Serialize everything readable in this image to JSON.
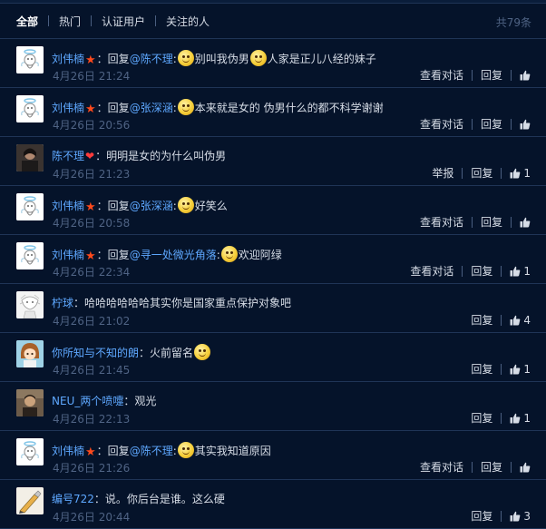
{
  "tabs": [
    {
      "label": "全部",
      "active": true
    },
    {
      "label": "热门",
      "active": false
    },
    {
      "label": "认证用户",
      "active": false
    },
    {
      "label": "关注的人",
      "active": false
    }
  ],
  "total": "共79条",
  "comments": [
    {
      "avatar": "angel",
      "user": "刘伟楠",
      "verified": true,
      "reply_prefix": "：回复",
      "mention": "@陈不理",
      "segments": [
        "别叫我伪男",
        "人家是正儿八经的妹子"
      ],
      "time": "4月26日 21:24",
      "view_dialog": "查看对话",
      "reply": "回复",
      "likes": ""
    },
    {
      "avatar": "angel",
      "user": "刘伟楠",
      "verified": true,
      "reply_prefix": "：回复",
      "mention": "@张深涵",
      "segments": [
        "本来就是女的 伪男什么的都不科学谢谢"
      ],
      "time": "4月26日 20:56",
      "view_dialog": "查看对话",
      "reply": "回复",
      "likes": ""
    },
    {
      "avatar": "photo-dark",
      "user": "陈不理",
      "heart": true,
      "text": "：明明是女的为什么叫伪男",
      "time": "4月26日 21:23",
      "report": "举报",
      "reply": "回复",
      "likes": "1"
    },
    {
      "avatar": "angel",
      "user": "刘伟楠",
      "verified": true,
      "reply_prefix": "：回复",
      "mention": "@张深涵",
      "segments": [
        "好笑么"
      ],
      "time": "4月26日 20:58",
      "view_dialog": "查看对话",
      "reply": "回复",
      "likes": ""
    },
    {
      "avatar": "angel",
      "user": "刘伟楠",
      "verified": true,
      "reply_prefix": "：回复",
      "mention": "@寻一处微光角落",
      "segments": [
        "欢迎阿绿"
      ],
      "time": "4月26日 22:34",
      "view_dialog": "查看对话",
      "reply": "回复",
      "likes": "1"
    },
    {
      "avatar": "sketch",
      "user": "柠球",
      "text": "：哈哈哈哈哈哈其实你是国家重点保护对象吧",
      "time": "4月26日 21:02",
      "reply": "回复",
      "likes": "4"
    },
    {
      "avatar": "anime",
      "user": "你所知与不知的朗",
      "text": "：火前留名",
      "emoji_after": true,
      "time": "4月26日 21:45",
      "reply": "回复",
      "likes": "1"
    },
    {
      "avatar": "photo-brown",
      "user": "NEU_两个喷嚏",
      "text": "：观光",
      "time": "4月26日 22:13",
      "reply": "回复",
      "likes": "1"
    },
    {
      "avatar": "angel",
      "user": "刘伟楠",
      "verified": true,
      "reply_prefix": "：回复",
      "mention": "@陈不理",
      "segments": [
        "其实我知道原因"
      ],
      "time": "4月26日 21:26",
      "view_dialog": "查看对话",
      "reply": "回复",
      "likes": ""
    },
    {
      "avatar": "drawing",
      "user": "编号722",
      "text": "：说。你后台是谁。这么硬",
      "time": "4月26日 20:44",
      "reply": "回复",
      "likes": "3"
    }
  ],
  "colors": {
    "background": "#05132a",
    "link": "#5ea8ff",
    "muted": "#4f6384",
    "divider": "#1f3456"
  },
  "icons": {
    "like": "thumbs-up-icon",
    "verified": "red-star-badge-icon",
    "heart": "heart-badge-icon"
  }
}
